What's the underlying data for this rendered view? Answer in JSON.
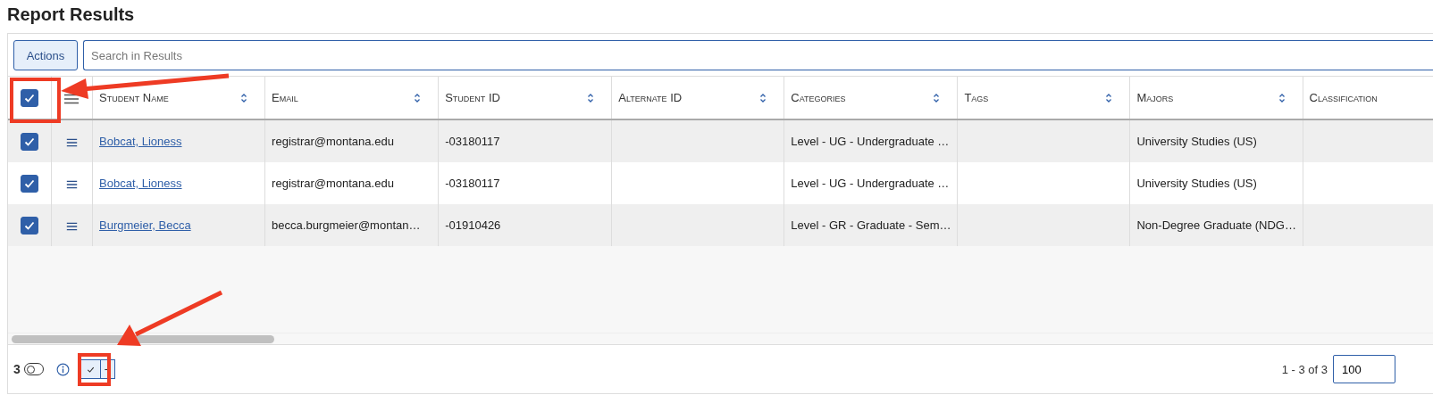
{
  "title": "Report Results",
  "toolbar": {
    "action_button": "Actions",
    "search": {
      "placeholder": "Search in Results"
    }
  },
  "table": {
    "select_all": {
      "checked": true
    },
    "columns": [
      {
        "label": "Student Name",
        "sortable": true
      },
      {
        "label": "Email",
        "sortable": true
      },
      {
        "label": "Student ID",
        "sortable": true
      },
      {
        "label": "Alternate ID",
        "sortable": true
      },
      {
        "label": "Categories",
        "sortable": true
      },
      {
        "label": "Tags",
        "sortable": true
      },
      {
        "label": "Majors",
        "sortable": true
      },
      {
        "label": "Classification",
        "sortable": false
      }
    ],
    "rows": [
      {
        "checked": true,
        "cells": [
          "Bobcat, Lioness",
          "registrar@montana.edu",
          "-03180117",
          "",
          "Level - UG - Undergraduate …",
          "",
          "University Studies (US)",
          ""
        ]
      },
      {
        "checked": true,
        "cells": [
          "Bobcat, Lioness",
          "registrar@montana.edu",
          "-03180117",
          "",
          "Level - UG - Undergraduate …",
          "",
          "University Studies (US)",
          ""
        ]
      },
      {
        "checked": true,
        "cells": [
          "Burgmeier, Becca",
          "becca.burgmeier@montan…",
          "-01910426",
          "",
          "Level - GR - Graduate - Sem…",
          "",
          "Non-Degree Graduate (NDG…",
          ""
        ]
      }
    ]
  },
  "footer": {
    "selected_count": "3",
    "toggle": {
      "on": false
    },
    "select_buttons": [
      {
        "kind": "check"
      },
      {
        "kind": "minus"
      }
    ],
    "pagination": "1 - 3 of 3",
    "page_size": "100"
  }
}
